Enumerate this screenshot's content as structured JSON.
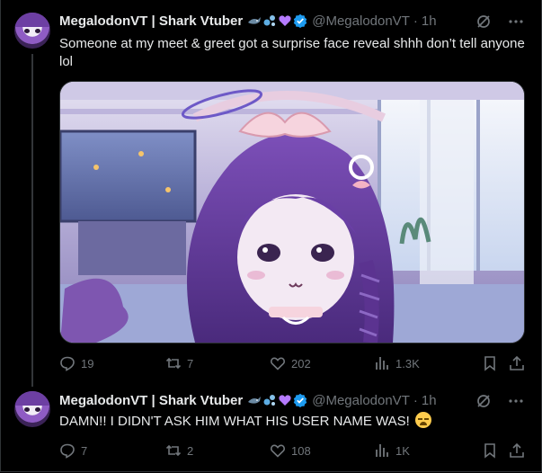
{
  "colors": {
    "verified": "#1d9bf0",
    "secondary_text": "#71767b",
    "primary_text": "#e7e9ea",
    "background": "#000000",
    "heart_badge": "#b57bff",
    "shark_badge": "#6b8aa3"
  },
  "tweets": [
    {
      "author_name": "MegalodonVT | Shark Vtuber",
      "handle": "@MegalodonVT",
      "separator": "·",
      "time": "1h",
      "badges": [
        "shark-emoji",
        "bubbles-emoji",
        "purple-heart-emoji",
        "verified-badge"
      ],
      "text": "Someone at my meet & greet got a surprise face reveal shhh don’t tell anyone lol",
      "media": {
        "description_icon": "anime-vtuber-image"
      },
      "actions": {
        "replies": "19",
        "reposts": "7",
        "likes": "202",
        "views": "1.3K"
      }
    },
    {
      "author_name": "MegalodonVT | Shark Vtuber",
      "handle": "@MegalodonVT",
      "separator": "·",
      "time": "1h",
      "badges": [
        "shark-emoji",
        "bubbles-emoji",
        "purple-heart-emoji",
        "verified-badge"
      ],
      "text": "DAMN!! I DIDN'T ASK HIM WHAT HIS USER NAME WAS!",
      "text_emoji": "loudly-crying-face-emoji",
      "actions": {
        "replies": "7",
        "reposts": "2",
        "likes": "108",
        "views": "1K"
      }
    }
  ]
}
